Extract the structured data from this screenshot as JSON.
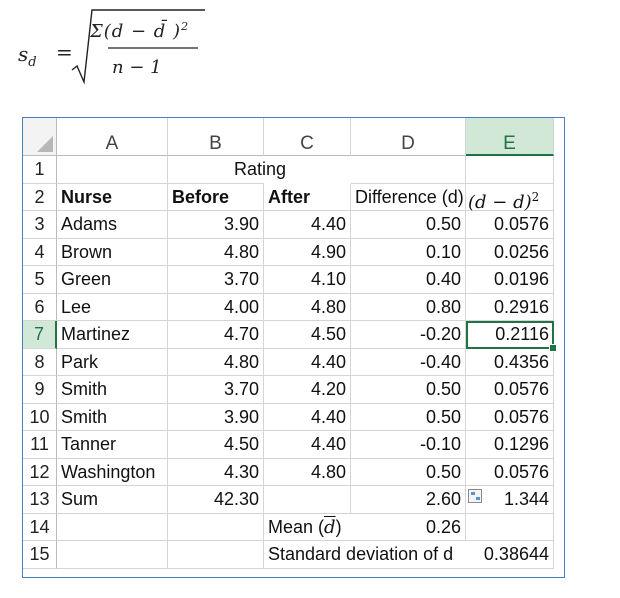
{
  "formula": {
    "lhs": "s",
    "lhs_sub": "d",
    "equals": "=",
    "numerator": "Σ(d  −  d̄ )",
    "numerator_exp": "2",
    "denominator": "n  − 1"
  },
  "sheet": {
    "columns": [
      "A",
      "B",
      "C",
      "D",
      "E"
    ],
    "selected_column": "E",
    "selected_row": "7",
    "rows": [
      {
        "num": "1",
        "A": "",
        "B": "",
        "C": "Rating",
        "D": "",
        "E": ""
      },
      {
        "num": "2",
        "A": "Nurse",
        "B": "Before",
        "C": "After",
        "D": "Difference (d)",
        "E": "(d  −  d)"
      },
      {
        "num": "3",
        "A": "Adams",
        "B": "3.90",
        "C": "4.40",
        "D": "0.50",
        "E": "0.0576"
      },
      {
        "num": "4",
        "A": "Brown",
        "B": "4.80",
        "C": "4.90",
        "D": "0.10",
        "E": "0.0256"
      },
      {
        "num": "5",
        "A": "Green",
        "B": "3.70",
        "C": "4.10",
        "D": "0.40",
        "E": "0.0196"
      },
      {
        "num": "6",
        "A": "Lee",
        "B": "4.00",
        "C": "4.80",
        "D": "0.80",
        "E": "0.2916"
      },
      {
        "num": "7",
        "A": "Martinez",
        "B": "4.70",
        "C": "4.50",
        "D": "-0.20",
        "E": "0.2116"
      },
      {
        "num": "8",
        "A": "Park",
        "B": "4.80",
        "C": "4.40",
        "D": "-0.40",
        "E": "0.4356"
      },
      {
        "num": "9",
        "A": "Smith",
        "B": "3.70",
        "C": "4.20",
        "D": "0.50",
        "E": "0.0576"
      },
      {
        "num": "10",
        "A": "Smith",
        "B": "3.90",
        "C": "4.40",
        "D": "0.50",
        "E": "0.0576"
      },
      {
        "num": "11",
        "A": "Tanner",
        "B": "4.50",
        "C": "4.40",
        "D": "-0.10",
        "E": "0.1296"
      },
      {
        "num": "12",
        "A": "Washington",
        "B": "4.30",
        "C": "4.80",
        "D": "0.50",
        "E": "0.0576"
      },
      {
        "num": "13",
        "A": "Sum",
        "B": "42.30",
        "C": "",
        "D": "2.60",
        "E": "1.344"
      },
      {
        "num": "14",
        "A": "",
        "B": "",
        "C": "Mean (d)",
        "D": "0.26",
        "E": ""
      },
      {
        "num": "15",
        "A": "",
        "B": "",
        "C": "Standard deviation of d",
        "D": "",
        "E": "0.38644"
      }
    ],
    "header_E_exp": "2",
    "mean_label_prefix": "Mean (",
    "mean_label_symbol": "d",
    "mean_label_suffix": ")",
    "colors": {
      "selection": "#217346",
      "selection_fill": "#d2e8d7",
      "frame": "#4a7ebb",
      "gridline": "#d4d4d4"
    },
    "icons": [
      "quick-analysis-icon",
      "select-all-triangle-icon"
    ]
  }
}
